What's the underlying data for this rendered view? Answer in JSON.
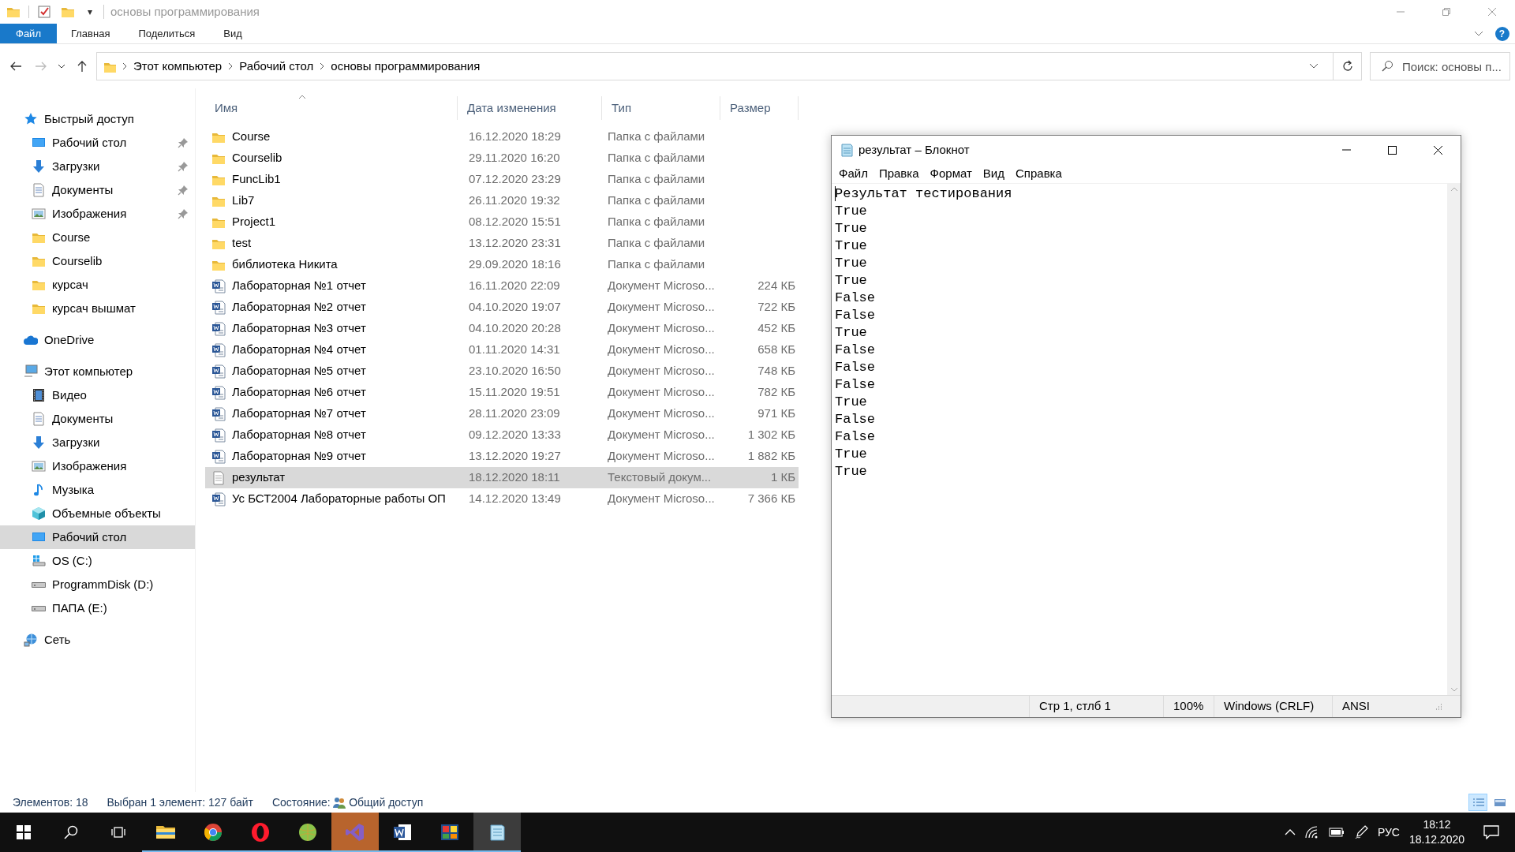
{
  "window": {
    "title": "основы программирования",
    "quick_access": [
      {
        "kind": "folder"
      },
      {
        "kind": "properties"
      },
      {
        "kind": "newfolder"
      }
    ],
    "dropdown": "▾"
  },
  "ribbon": {
    "tabs": [
      {
        "label": "Файл",
        "kind": "file",
        "selected": false
      },
      {
        "label": "Главная",
        "kind": "tab",
        "selected": false
      },
      {
        "label": "Поделиться",
        "kind": "tab",
        "selected": false
      },
      {
        "label": "Вид",
        "kind": "tab",
        "selected": false
      }
    ],
    "help": "?"
  },
  "navigation": {
    "back_enabled": true,
    "forward_enabled": false,
    "breadcrumbs": [
      "Этот компьютер",
      "Рабочий стол",
      "основы программирования"
    ],
    "search": {
      "placeholder": "Поиск: основы п..."
    }
  },
  "sidebar": [
    {
      "label": "Быстрый доступ",
      "kind": "star",
      "selected": false,
      "children": [
        {
          "label": "Рабочий стол",
          "kind": "desktop",
          "pinned": true,
          "selected": false
        },
        {
          "label": "Загрузки",
          "kind": "download",
          "pinned": true,
          "selected": false
        },
        {
          "label": "Документы",
          "kind": "documents",
          "pinned": true,
          "selected": false
        },
        {
          "label": "Изображения",
          "kind": "pictures",
          "pinned": true,
          "selected": false
        },
        {
          "label": "Course",
          "kind": "folder",
          "pinned": false,
          "selected": false
        },
        {
          "label": "Courselib",
          "kind": "folder",
          "pinned": false,
          "selected": false
        },
        {
          "label": "курсач",
          "kind": "folder",
          "pinned": false,
          "selected": false
        },
        {
          "label": "курсач вышмат",
          "kind": "folder",
          "pinned": false,
          "selected": false
        }
      ]
    },
    {
      "label": "OneDrive",
      "kind": "cloud",
      "selected": false
    },
    {
      "label": "Этот компьютер",
      "kind": "computer",
      "selected": false,
      "children": [
        {
          "label": "Видео",
          "kind": "video",
          "pinned": false,
          "selected": false
        },
        {
          "label": "Документы",
          "kind": "documents",
          "pinned": false,
          "selected": false
        },
        {
          "label": "Загрузки",
          "kind": "download",
          "pinned": false,
          "selected": false
        },
        {
          "label": "Изображения",
          "kind": "pictures",
          "pinned": false,
          "selected": false
        },
        {
          "label": "Музыка",
          "kind": "music",
          "pinned": false,
          "selected": false
        },
        {
          "label": "Объемные объекты",
          "kind": "objects",
          "pinned": false,
          "selected": false
        },
        {
          "label": "Рабочий стол",
          "kind": "desktop",
          "pinned": false,
          "selected": true
        },
        {
          "label": "OS (C:)",
          "kind": "drive-os",
          "pinned": false,
          "selected": false
        },
        {
          "label": "ProgrammDisk (D:)",
          "kind": "drive",
          "pinned": false,
          "selected": false
        },
        {
          "label": "ПАПА (E:)",
          "kind": "drive",
          "pinned": false,
          "selected": false
        }
      ]
    },
    {
      "label": "Сеть",
      "kind": "network",
      "selected": false
    }
  ],
  "file_list": {
    "columns": [
      "Имя",
      "Дата изменения",
      "Тип",
      "Размер"
    ],
    "rows": [
      {
        "kind": "folder",
        "name": "Course",
        "date": "16.12.2020 18:29",
        "type": "Папка с файлами",
        "selected": false
      },
      {
        "kind": "folder",
        "name": "Courselib",
        "date": "29.11.2020 16:20",
        "type": "Папка с файлами",
        "selected": false
      },
      {
        "kind": "folder",
        "name": "FuncLib1",
        "date": "07.12.2020 23:29",
        "type": "Папка с файлами",
        "selected": false
      },
      {
        "kind": "folder",
        "name": "Lib7",
        "date": "26.11.2020 19:32",
        "type": "Папка с файлами",
        "selected": false
      },
      {
        "kind": "folder",
        "name": "Project1",
        "date": "08.12.2020 15:51",
        "type": "Папка с файлами",
        "selected": false
      },
      {
        "kind": "folder",
        "name": "test",
        "date": "13.12.2020 23:31",
        "type": "Папка с файлами",
        "selected": false
      },
      {
        "kind": "folder",
        "name": "библиотека Никита",
        "date": "29.09.2020 18:16",
        "type": "Папка с файлами",
        "selected": false
      },
      {
        "kind": "word",
        "name": "Лабораторная №1 отчет",
        "date": "16.11.2020 22:09",
        "type": "Документ Microso...",
        "size": "224 КБ",
        "selected": false
      },
      {
        "kind": "word",
        "name": "Лабораторная №2 отчет",
        "date": "04.10.2020 19:07",
        "type": "Документ Microso...",
        "size": "722 КБ",
        "selected": false
      },
      {
        "kind": "word",
        "name": "Лабораторная №3 отчет",
        "date": "04.10.2020 20:28",
        "type": "Документ Microso...",
        "size": "452 КБ",
        "selected": false
      },
      {
        "kind": "word",
        "name": "Лабораторная №4 отчет",
        "date": "01.11.2020 14:31",
        "type": "Документ Microso...",
        "size": "658 КБ",
        "selected": false
      },
      {
        "kind": "word",
        "name": "Лабораторная №5 отчет",
        "date": "23.10.2020 16:50",
        "type": "Документ Microso...",
        "size": "748 КБ",
        "selected": false
      },
      {
        "kind": "word",
        "name": "Лабораторная №6 отчет",
        "date": "15.11.2020 19:51",
        "type": "Документ Microso...",
        "size": "782 КБ",
        "selected": false
      },
      {
        "kind": "word",
        "name": "Лабораторная №7 отчет",
        "date": "28.11.2020 23:09",
        "type": "Документ Microso...",
        "size": "971 КБ",
        "selected": false
      },
      {
        "kind": "word",
        "name": "Лабораторная №8 отчет",
        "date": "09.12.2020 13:33",
        "type": "Документ Microso...",
        "size": "1 302 КБ",
        "selected": false
      },
      {
        "kind": "word",
        "name": "Лабораторная №9 отчет",
        "date": "13.12.2020 19:27",
        "type": "Документ Microso...",
        "size": "1 882 КБ",
        "selected": false
      },
      {
        "kind": "text",
        "name": "результат",
        "date": "18.12.2020 18:11",
        "type": "Текстовый докум...",
        "size": "1 КБ",
        "selected": true
      },
      {
        "kind": "word",
        "name": "Ус БСТ2004 Лабораторные работы ОП",
        "date": "14.12.2020 13:49",
        "type": "Документ Microso...",
        "size": "7 366 КБ",
        "selected": false
      }
    ]
  },
  "status_bar": {
    "count": "Элементов: 18",
    "selection": "Выбран 1 элемент: 127 байт",
    "state_label": "Состояние:",
    "state_value": "Общий доступ",
    "views": [
      {
        "kind": "details",
        "selected": true
      },
      {
        "kind": "tiles",
        "selected": false
      }
    ]
  },
  "notepad": {
    "title": "результат – Блокнот",
    "menu": [
      "Файл",
      "Правка",
      "Формат",
      "Вид",
      "Справка"
    ],
    "lines": [
      "Результат тестирования",
      "True",
      "True",
      "True",
      "True",
      "True",
      "False",
      "False",
      "True",
      "False",
      "False",
      "False",
      "True",
      "False",
      "False",
      "True",
      "True"
    ],
    "status": {
      "position": "Стр 1, стлб 1",
      "zoom": "100%",
      "line_endings": "Windows (CRLF)",
      "encoding": "ANSI"
    }
  },
  "taskbar": {
    "apps": [
      {
        "kind": "explorer",
        "active": false,
        "flashing": false
      },
      {
        "kind": "chrome",
        "active": false,
        "flashing": false
      },
      {
        "kind": "opera",
        "active": false,
        "flashing": false
      },
      {
        "kind": "ball",
        "active": false,
        "flashing": false
      },
      {
        "kind": "vs",
        "active": false,
        "flashing": true
      },
      {
        "kind": "word",
        "active": false,
        "flashing": false
      },
      {
        "kind": "tiles",
        "active": false,
        "flashing": false
      },
      {
        "kind": "notepad",
        "active": true,
        "flashing": false
      }
    ],
    "language": "РУС",
    "time": "18:12",
    "date": "18.12.2020"
  }
}
